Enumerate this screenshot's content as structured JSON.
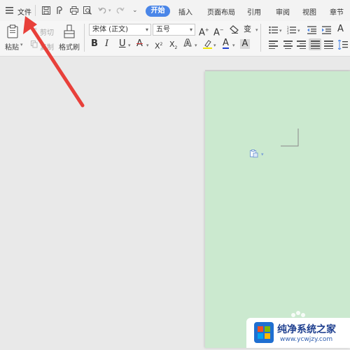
{
  "tabs": {
    "file": "文件",
    "start": "开始",
    "insert": "插入",
    "layout": "页面布局",
    "reference": "引用",
    "review": "审阅",
    "view": "视图",
    "section": "章节"
  },
  "ribbon": {
    "paste": "粘贴",
    "cut": "剪切",
    "copy": "复制",
    "format_painter": "格式刷",
    "font_name": "宋体 (正文)",
    "font_size": "五号"
  },
  "icons": {
    "menu": "menu-icon",
    "save": "save-icon",
    "print": "print-icon",
    "undo": "undo-icon",
    "redo": "redo-icon"
  },
  "colors": {
    "accent": "#4a86e8",
    "page_background": "#cbe9cf",
    "arrow": "#e8403a",
    "font_color_underline": "#1f3fd1",
    "highlight_underline": "#f2e600"
  },
  "watermark": {
    "title": "纯净系统之家",
    "url": "www.ycwjzy.com"
  }
}
